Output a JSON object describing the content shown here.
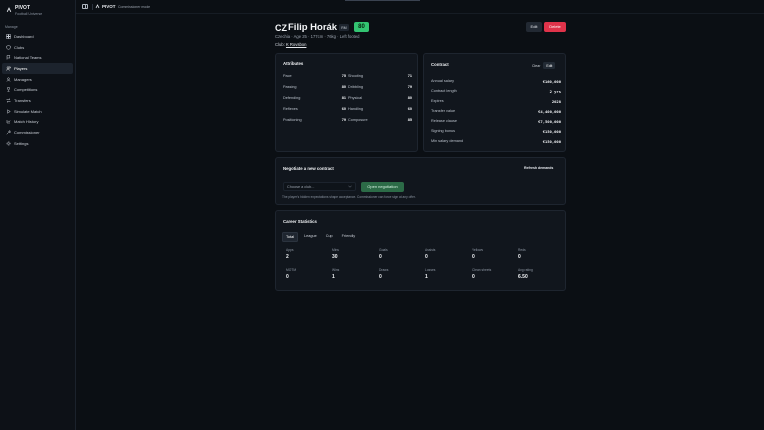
{
  "app": {
    "brand": "PIVOT",
    "subtitle": "Football Universe",
    "mode": "Commissioner mode"
  },
  "sidebar": {
    "section": "Manage",
    "items": [
      {
        "label": "Dashboard",
        "icon": "grid-icon"
      },
      {
        "label": "Clubs",
        "icon": "shield-icon"
      },
      {
        "label": "National Teams",
        "icon": "flag-icon"
      },
      {
        "label": "Players",
        "icon": "users-icon",
        "active": true
      },
      {
        "label": "Managers",
        "icon": "user-icon"
      },
      {
        "label": "Competitions",
        "icon": "trophy-icon"
      },
      {
        "label": "Transfers",
        "icon": "transfer-icon"
      },
      {
        "label": "Simulate Match",
        "icon": "play-icon"
      },
      {
        "label": "Match History",
        "icon": "history-icon"
      },
      {
        "label": "Commissioner",
        "icon": "wrench-icon"
      },
      {
        "label": "Settings",
        "icon": "gear-icon"
      }
    ]
  },
  "player": {
    "flag": "CZ",
    "name": "Filip Horák",
    "position": "RM",
    "overall": "80",
    "meta": "Czechia · Age 25 · 177cm · 76kg · Left footed",
    "club_prefix": "Club:",
    "club": "K Rovsbon"
  },
  "actions": {
    "edit": "Edit",
    "delete": "Delete"
  },
  "attributes": {
    "title": "Attributes",
    "left": [
      {
        "label": "Pace",
        "value": "75"
      },
      {
        "label": "Passing",
        "value": "80"
      },
      {
        "label": "Defending",
        "value": "81"
      },
      {
        "label": "Reflexes",
        "value": "60"
      },
      {
        "label": "Positioning",
        "value": "79"
      }
    ],
    "right": [
      {
        "label": "Shooting",
        "value": "71"
      },
      {
        "label": "Dribbling",
        "value": "79"
      },
      {
        "label": "Physical",
        "value": "80"
      },
      {
        "label": "Handling",
        "value": "60"
      },
      {
        "label": "Composure",
        "value": "85"
      }
    ]
  },
  "contract": {
    "title": "Contract",
    "toggle": [
      "Clear",
      "Edit"
    ],
    "rows": [
      {
        "label": "Annual salary",
        "value": "€160,000"
      },
      {
        "label": "Contract length",
        "value": "2 yrs"
      },
      {
        "label": "Expires",
        "value": "2028"
      },
      {
        "label": "Transfer value",
        "value": "€4,400,000"
      },
      {
        "label": "Release clause",
        "value": "€7,500,000"
      },
      {
        "label": "Signing bonus",
        "value": "€150,000"
      },
      {
        "label": "Min salary demand",
        "value": "€150,000"
      }
    ]
  },
  "negotiate": {
    "title": "Negotiate a new contract",
    "refresh": "Refresh demands",
    "select_placeholder": "Choose a club...",
    "open_button": "Open negotiation",
    "hint": "The player's hidden expectations shape acceptance. Commissioner can force sign at any offer."
  },
  "career": {
    "title": "Career Statistics",
    "tabs": [
      "Total",
      "League",
      "Cup",
      "Friendly"
    ],
    "stats": [
      {
        "label": "Apps",
        "value": "2"
      },
      {
        "label": "Mins",
        "value": "30"
      },
      {
        "label": "Goals",
        "value": "0"
      },
      {
        "label": "Assists",
        "value": "0"
      },
      {
        "label": "Yellows",
        "value": "0"
      },
      {
        "label": "Reds",
        "value": "0"
      },
      {
        "label": "MOTM",
        "value": "0"
      },
      {
        "label": "Wins",
        "value": "1"
      },
      {
        "label": "Draws",
        "value": "0"
      },
      {
        "label": "Losses",
        "value": "1"
      },
      {
        "label": "Clean sheets",
        "value": "0"
      },
      {
        "label": "Avg rating",
        "value": "6.50"
      }
    ]
  },
  "colors": {
    "background": "#0b0f14",
    "accent_green": "#33c472",
    "danger": "#e0334a"
  }
}
